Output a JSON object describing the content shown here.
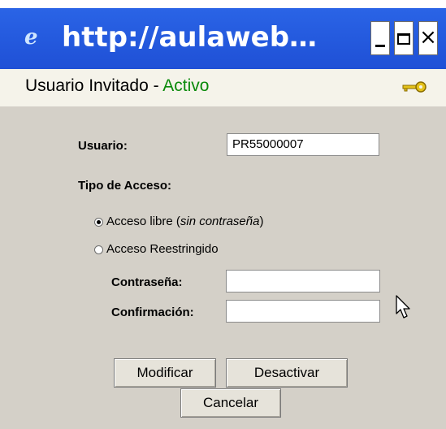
{
  "window": {
    "title": "http://aulaweb…",
    "icon": "ie-e-icon",
    "controls": [
      "minimize-icon",
      "maximize-icon",
      "close-icon"
    ]
  },
  "status": {
    "user_label": "Usuario Invitado",
    "separator": " - ",
    "state": "Activo",
    "state_color": "#0a8a0a",
    "icon": "key-icon"
  },
  "form": {
    "usuario_label": "Usuario:",
    "usuario_value": "PR55000007",
    "tipo_acceso_label": "Tipo de Acceso:",
    "options": [
      {
        "label_prefix": "Acceso libre (",
        "label_italic": "sin contraseña",
        "label_suffix": ")",
        "selected": true
      },
      {
        "label": "Acceso Reestringido",
        "selected": false
      }
    ],
    "password_label": "Contraseña:",
    "password_value": "",
    "confirm_label": "Confirmación:",
    "confirm_value": ""
  },
  "buttons": {
    "modify": "Modificar",
    "deactivate": "Desactivar",
    "cancel": "Cancelar"
  },
  "colors": {
    "titlebar": "#1f50d6",
    "dialog_bg": "#d4d0c8",
    "status_bg": "#f5f3ea"
  }
}
